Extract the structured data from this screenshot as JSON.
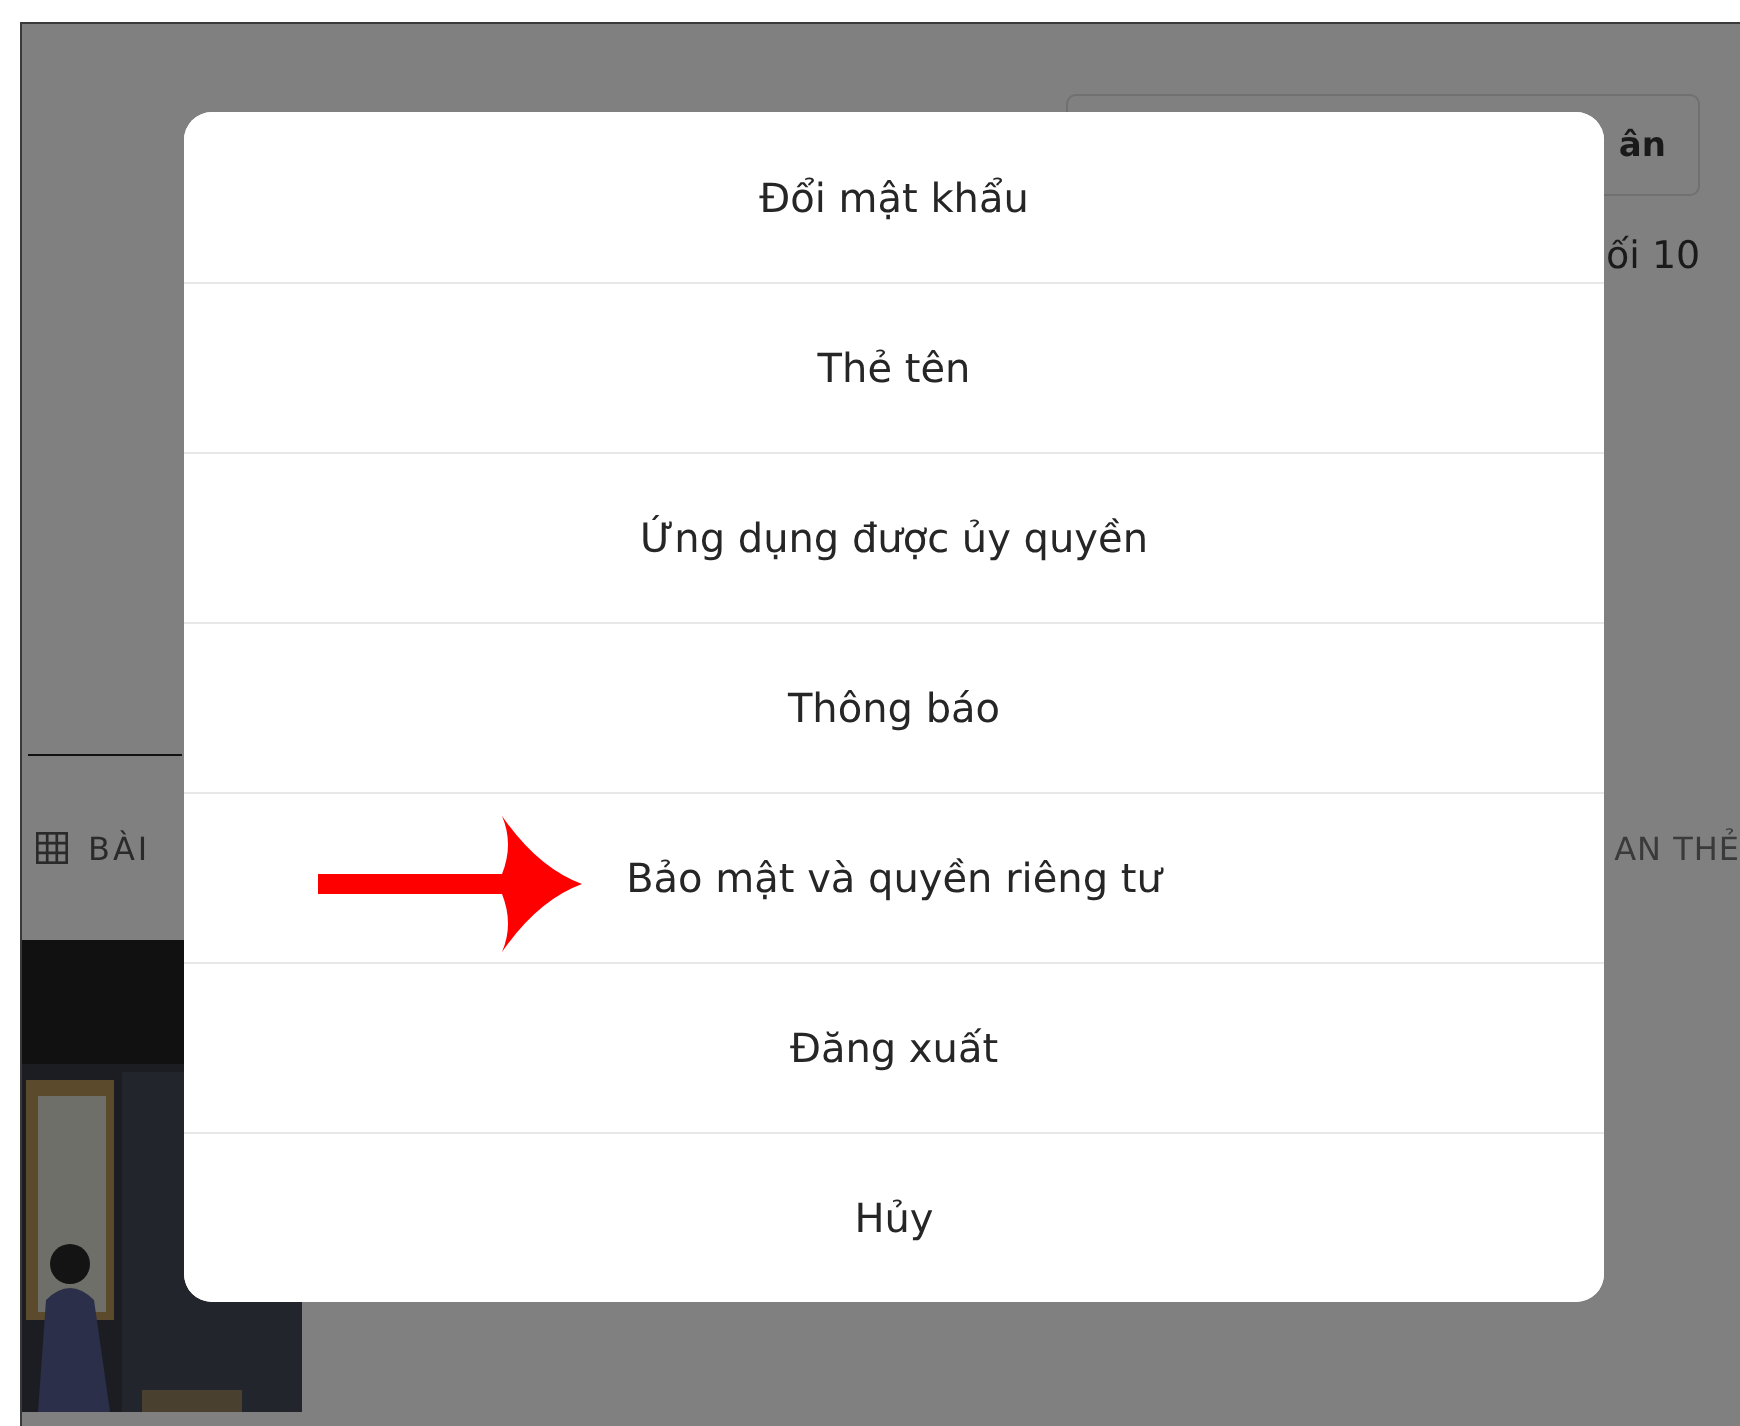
{
  "background_page": {
    "header_button": "ân",
    "stats_text": "ối 10",
    "tabs": [
      {
        "label": "BÀI",
        "selected": true,
        "kind": "grid"
      },
      {
        "label": "AN THẺ",
        "selected": false,
        "kind": "plain"
      }
    ]
  },
  "menu": {
    "items": [
      {
        "label": "Đổi mật khẩu"
      },
      {
        "label": "Thẻ tên"
      },
      {
        "label": "Ứng dụng được ủy quyền"
      },
      {
        "label": "Thông báo"
      },
      {
        "label": "Bảo mật và quyền riêng tư"
      },
      {
        "label": "Đăng xuất"
      },
      {
        "label": "Hủy"
      }
    ]
  },
  "annotation": {
    "kind": "arrow",
    "color": "#ff0000"
  }
}
